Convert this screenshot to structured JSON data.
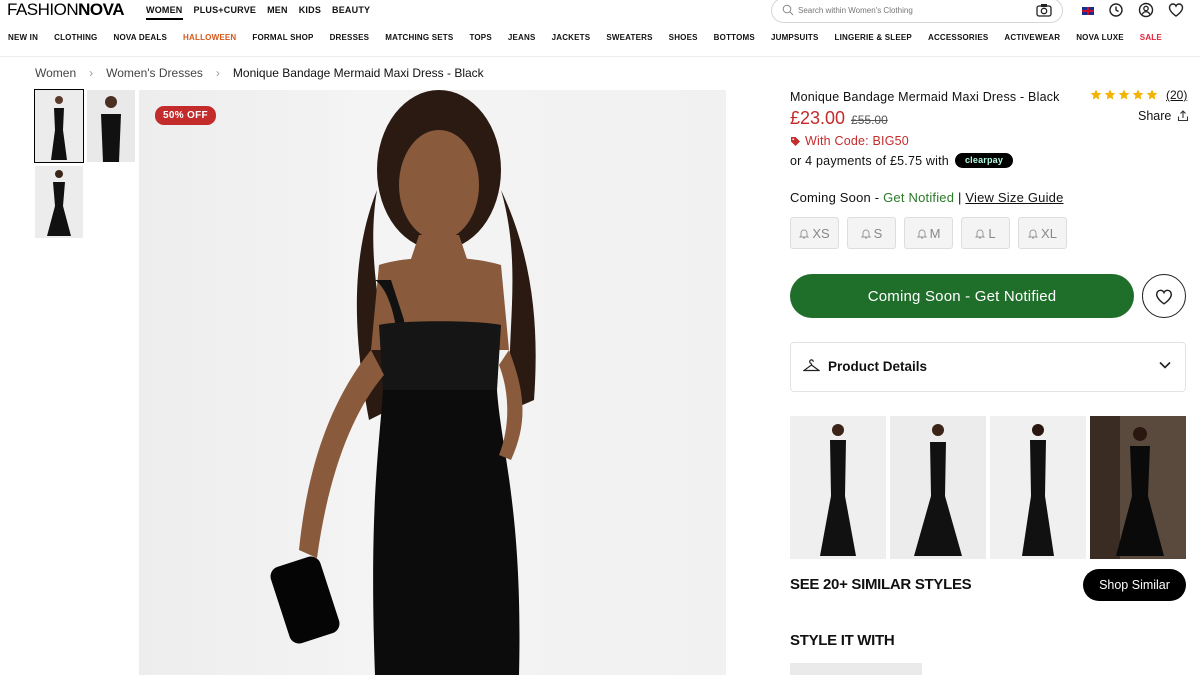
{
  "header": {
    "logo_part1": "FASHION",
    "logo_part2": "NOVA",
    "top_nav": [
      "WOMEN",
      "PLUS+CURVE",
      "MEN",
      "KIDS",
      "BEAUTY"
    ],
    "active_top_nav": "WOMEN",
    "search_placeholder": "Search within Women's Clothing",
    "icons": [
      "uk-flag-icon",
      "history-icon",
      "account-icon",
      "wishlist-heart-icon"
    ]
  },
  "category_nav": [
    "NEW IN",
    "CLOTHING",
    "NOVA DEALS",
    "HALLOWEEN",
    "FORMAL SHOP",
    "DRESSES",
    "MATCHING SETS",
    "TOPS",
    "JEANS",
    "JACKETS",
    "SWEATERS",
    "SHOES",
    "BOTTOMS",
    "JUMPSUITS",
    "LINGERIE & SLEEP",
    "ACCESSORIES",
    "ACTIVEWEAR",
    "NOVA LUXE",
    "SALE"
  ],
  "colors": {
    "halloween": "#d4581b",
    "sale": "#e0243a",
    "price": "#c42b2b",
    "cta": "#1f6f2b",
    "badge": "#c42b2b"
  },
  "breadcrumb": [
    "Women",
    "Women's Dresses",
    "Monique Bandage Mermaid Maxi Dress - Black"
  ],
  "gallery": {
    "badge": "50% OFF",
    "thumb_count": 3
  },
  "product": {
    "title": "Monique Bandage Mermaid Maxi Dress - Black",
    "rating_stars": 5,
    "rating_count": "(20)",
    "share_label": "Share",
    "price_now": "£23.00",
    "price_was": "£55.00",
    "promo_code": "With Code: BIG50",
    "payments_prefix": "or 4 payments of £5.75 with",
    "clearpay_label": "clearpay",
    "availability_status": "Coming Soon",
    "availability_dash": " - ",
    "availability_action": "Get Notified",
    "availability_sep": " | ",
    "size_guide": "View Size Guide",
    "sizes": [
      "XS",
      "S",
      "M",
      "L",
      "XL"
    ],
    "cta_label": "Coming Soon - Get Notified",
    "details_label": "Product Details"
  },
  "similar": {
    "heading": "SEE 20+ SIMILAR STYLES",
    "button": "Shop Similar"
  },
  "style_with": {
    "heading": "STYLE IT WITH"
  }
}
